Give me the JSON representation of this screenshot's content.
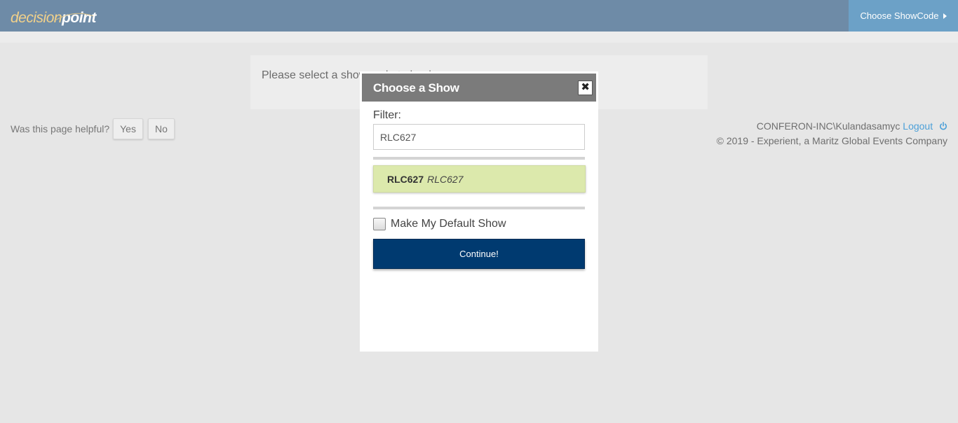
{
  "header": {
    "logo_part1": "decision",
    "logo_part2": "point",
    "choose_showcode_label": "Choose ShowCode"
  },
  "notice": {
    "text": "Please select a show code to begin."
  },
  "helpful": {
    "question": "Was this page helpful?",
    "yes_label": "Yes",
    "no_label": "No"
  },
  "footer": {
    "user": "CONFERON-INC\\Kulandasamyc",
    "logout_label": "Logout",
    "copyright": "© 2019 - Experient, a Maritz Global Events Company"
  },
  "modal": {
    "title": "Choose a Show",
    "close_glyph": "✖",
    "filter_label": "Filter:",
    "filter_value": "RLC627",
    "results": [
      {
        "code": "RLC627",
        "name": "RLC627"
      }
    ],
    "default_label": "Make My Default Show",
    "continue_label": "Continue!"
  },
  "colors": {
    "header_bg": "#6e8ba7",
    "showcode_bg": "#6ca1c7",
    "continue_bg": "#003a70",
    "result_bg": "#dce9ac",
    "logout_link": "#4da0d8"
  },
  "icons": {
    "showcode_caret": "caret-right-icon",
    "logout": "power-icon",
    "close": "close-icon"
  }
}
